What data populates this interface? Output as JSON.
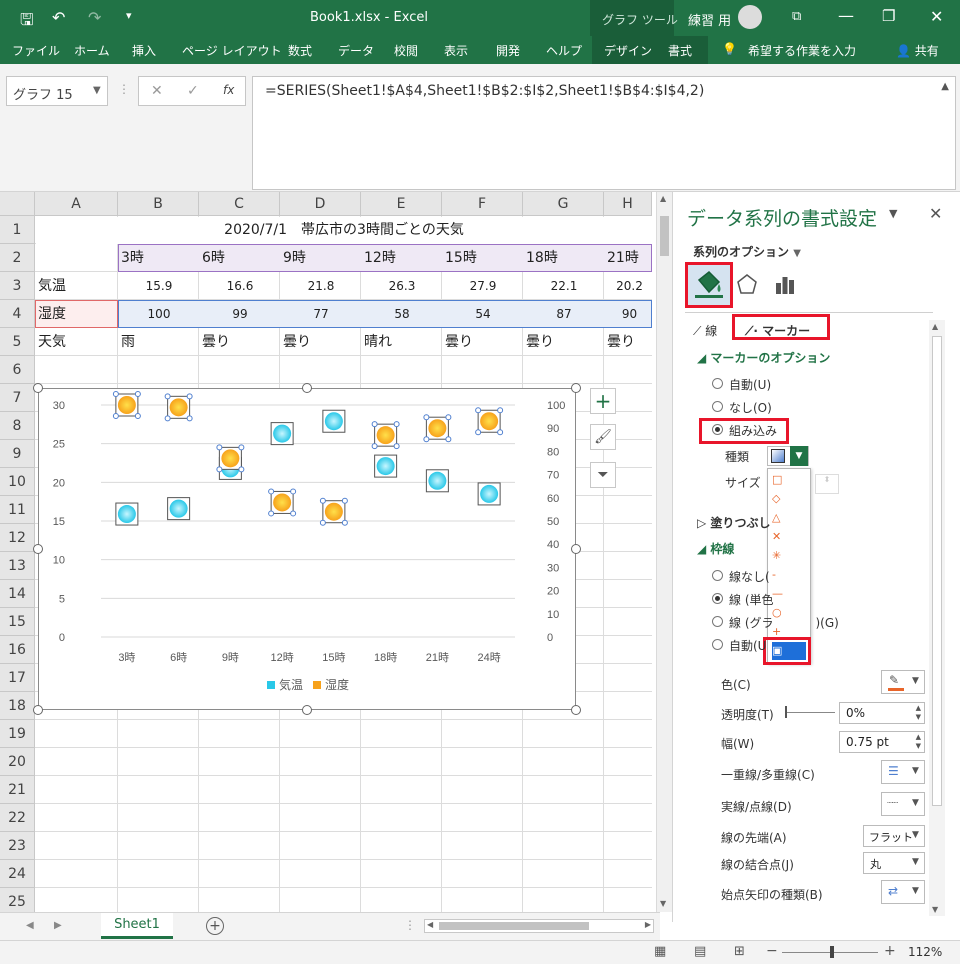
{
  "titlebar": {
    "filename": "Book1.xlsx",
    "sep": "-",
    "app": "Excel",
    "context_tab": "グラフ ツール",
    "user": "練習 用"
  },
  "ribbon": {
    "tabs": [
      "ファイル",
      "ホーム",
      "挿入",
      "ページ レイアウト",
      "数式",
      "データ",
      "校閲",
      "表示",
      "開発",
      "ヘルプ",
      "デザイン",
      "書式"
    ],
    "tell_me": "希望する作業を入力",
    "share": "共有"
  },
  "formula_bar": {
    "name_box": "グラフ 15",
    "cancel": "✕",
    "enter": "✓",
    "fx": "fx",
    "formula": "=SERIES(Sheet1!$A$4,Sheet1!$B$2:$I$2,Sheet1!$B$4:$I$4,2)"
  },
  "sheet": {
    "columns": [
      "A",
      "B",
      "C",
      "D",
      "E",
      "F",
      "G",
      "H"
    ],
    "rows": [
      "1",
      "2",
      "3",
      "4",
      "5",
      "6",
      "7",
      "8",
      "9",
      "10",
      "11",
      "12",
      "13",
      "14",
      "15",
      "16",
      "17",
      "18",
      "19",
      "20",
      "21",
      "22",
      "23",
      "24",
      "25"
    ],
    "title": "2020/7/1　帯広市の3時間ごとの天気",
    "row2": [
      "3時",
      "6時",
      "9時",
      "12時",
      "15時",
      "18時",
      "21時"
    ],
    "row3_label": "気温",
    "row3": [
      "15.9",
      "16.6",
      "21.8",
      "26.3",
      "27.9",
      "22.1",
      "20.2"
    ],
    "row4_label": "湿度",
    "row4": [
      "100",
      "99",
      "77",
      "58",
      "54",
      "87",
      "90"
    ],
    "row5_label": "天気",
    "row5": [
      "雨",
      "曇り",
      "曇り",
      "晴れ",
      "曇り",
      "曇り",
      "曇り"
    ],
    "tab_name": "Sheet1"
  },
  "chart_data": {
    "type": "scatter",
    "categories": [
      "3時",
      "6時",
      "9時",
      "12時",
      "15時",
      "18時",
      "21時",
      "24時"
    ],
    "series": [
      {
        "name": "気温",
        "values": [
          15.9,
          16.6,
          21.8,
          26.3,
          27.9,
          22.1,
          20.2,
          18.5
        ],
        "color": "#29c8e8",
        "axis": "left"
      },
      {
        "name": "湿度",
        "values": [
          100,
          99,
          77,
          58,
          54,
          87,
          90,
          93
        ],
        "color": "#f7a21b",
        "axis": "right"
      }
    ],
    "y_left": {
      "ticks": [
        "0",
        "5",
        "10",
        "15",
        "20",
        "25",
        "30"
      ],
      "min": 0,
      "max": 30
    },
    "y_right": {
      "ticks": [
        "0",
        "10",
        "20",
        "30",
        "40",
        "50",
        "60",
        "70",
        "80",
        "90",
        "100"
      ],
      "min": 0,
      "max": 100
    },
    "grid": true,
    "legend": "bottom"
  },
  "pane": {
    "title": "データ系列の書式設定",
    "options_label": "系列のオプション",
    "tab_line": "線",
    "tab_marker": "マーカー",
    "marker_options": "マーカーのオプション",
    "radio_auto": "自動(U)",
    "radio_none": "なし(O)",
    "radio_builtin": "組み込み",
    "type_label": "種類",
    "size_label": "サイズ",
    "fill_section": "塗りつぶし",
    "border_section": "枠線",
    "radio_noline": "線なし(",
    "radio_solid": "線 (単色",
    "radio_gradient": "線 (グラ",
    "radio_gradient_suffix": ")(G)",
    "radio_auto2": "自動(U",
    "color_label": "色(C)",
    "transparency_label": "透明度(T)",
    "transparency_value": "0%",
    "width_label": "幅(W)",
    "width_value": "0.75 pt",
    "compound_label": "一重線/多重線(C)",
    "dash_label": "実線/点線(D)",
    "cap_label": "線の先端(A)",
    "cap_value": "フラット",
    "join_label": "線の結合点(J)",
    "join_value": "丸",
    "arrow_label": "始点矢印の種類(B)",
    "marker_shapes": [
      "□",
      "◇",
      "△",
      "✕",
      "✳",
      "-",
      "—",
      "○",
      "+",
      "▣"
    ]
  },
  "status": {
    "zoom": "112%"
  }
}
